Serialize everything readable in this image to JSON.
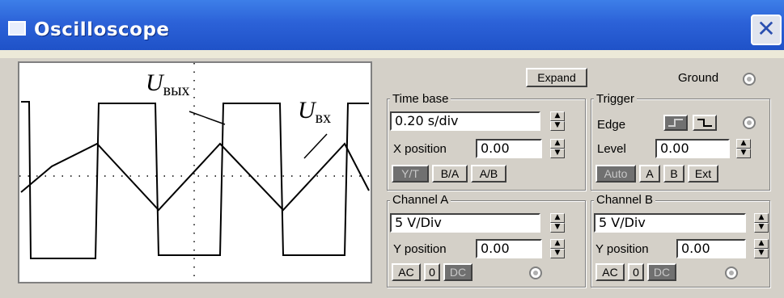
{
  "window": {
    "title": "Oscilloscope",
    "close_glyph": "✕"
  },
  "screen": {
    "label_out": "U",
    "label_out_sub": "вых",
    "label_in": "U",
    "label_in_sub": "вх"
  },
  "controls": {
    "expand_label": "Expand",
    "ground_label": "Ground",
    "time_base": {
      "title": "Time base",
      "value": "0.20 s/div",
      "x_position_label": "X position",
      "x_position_value": "0.00",
      "modes": [
        "Y/T",
        "B/A",
        "A/B"
      ],
      "active_mode": "Y/T"
    },
    "trigger": {
      "title": "Trigger",
      "edge_label": "Edge",
      "level_label": "Level",
      "level_value": "0.00",
      "sources": [
        "Auto",
        "A",
        "B",
        "Ext"
      ],
      "active_source": "Auto"
    },
    "channel_a": {
      "title": "Channel A",
      "scale": "5 V/Div",
      "y_position_label": "Y position",
      "y_position_value": "0.00",
      "coupling": [
        "AC",
        "0",
        "DC"
      ],
      "active_coupling": "DC"
    },
    "channel_b": {
      "title": "Channel B",
      "scale": "5 V/Div",
      "y_position_label": "Y position",
      "y_position_value": "0.00",
      "coupling": [
        "AC",
        "0",
        "DC"
      ],
      "active_coupling": "DC"
    }
  },
  "colors": {
    "title_bar": "#2c62d8",
    "panel_bg": "#d4d0c8",
    "active_button": "#707070",
    "trace": "#000000"
  },
  "icons": {
    "window": "window-icon",
    "close": "close-icon",
    "spin": "spin-arrows-icon",
    "edge_rise": "rising-edge-icon",
    "edge_fall": "falling-edge-icon"
  }
}
